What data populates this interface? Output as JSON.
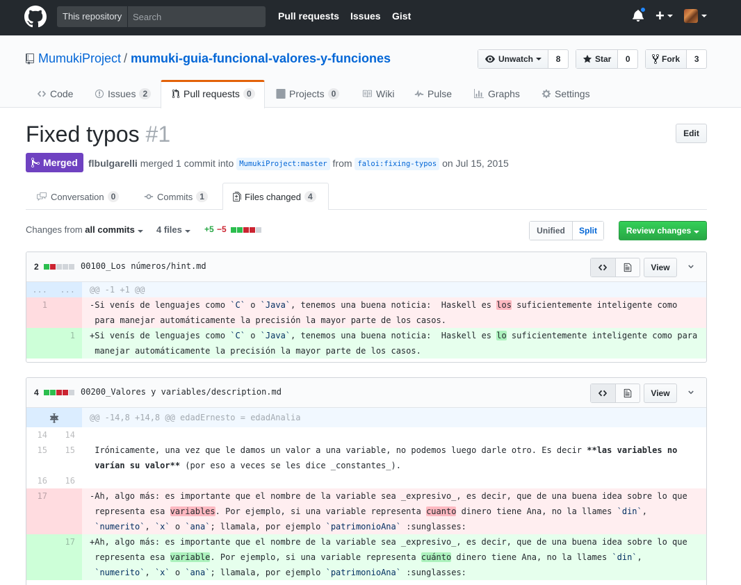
{
  "header": {
    "scope_label": "This repository",
    "search_placeholder": "Search",
    "nav": [
      "Pull requests",
      "Issues",
      "Gist"
    ]
  },
  "repo": {
    "owner": "MumukiProject",
    "separator": "/",
    "name": "mumuki-guia-funcional-valores-y-funciones",
    "watch_label": "Unwatch",
    "watch_count": "8",
    "star_label": "Star",
    "star_count": "0",
    "fork_label": "Fork",
    "fork_count": "3",
    "tabs": [
      {
        "label": "Code",
        "count": ""
      },
      {
        "label": "Issues",
        "count": "2"
      },
      {
        "label": "Pull requests",
        "count": "0"
      },
      {
        "label": "Projects",
        "count": "0"
      },
      {
        "label": "Wiki",
        "count": ""
      },
      {
        "label": "Pulse",
        "count": ""
      },
      {
        "label": "Graphs",
        "count": ""
      },
      {
        "label": "Settings",
        "count": ""
      }
    ]
  },
  "pr": {
    "title": "Fixed typos",
    "number": "#1",
    "edit_label": "Edit",
    "state": "Merged",
    "author": "flbulgarelli",
    "merged_text": "merged 1 commit into",
    "base_ref": "MumukiProject:master",
    "from_text": "from",
    "head_ref": "faloi:fixing-typos",
    "date_text": "on Jul 15, 2015",
    "tabs": [
      {
        "label": "Conversation",
        "count": "0"
      },
      {
        "label": "Commits",
        "count": "1"
      },
      {
        "label": "Files changed",
        "count": "4"
      }
    ]
  },
  "toolbar": {
    "changes_from": "Changes from",
    "changes_value": "all commits",
    "files_label": "4 files",
    "additions": "+5",
    "deletions": "−5",
    "unified_label": "Unified",
    "split_label": "Split",
    "review_label": "Review changes"
  },
  "files": [
    {
      "count": "2",
      "name": "00100_Los números/hint.md",
      "view_label": "View",
      "hunk_old": "...",
      "hunk_new": "...",
      "hunk": "@@ -1 +1 @@",
      "del_ln": "1",
      "del_pre": "-Si venís de lenguajes como ",
      "del_t1": "`C`",
      "del_mid1": " o ",
      "del_t2": "`Java`",
      "del_mid2": ", tenemos una buena noticia:  Haskell es ",
      "del_word": "los",
      "del_post": " suficientemente inteligente como",
      "del_line2": "para manejar automáticamente la precisión la mayor parte de los casos.",
      "add_ln": "1",
      "add_pre": "+Si venís de lenguajes como ",
      "add_t1": "`C`",
      "add_mid1": " o ",
      "add_t2": "`Java`",
      "add_mid2": ", tenemos una buena noticia:  Haskell es ",
      "add_word": "lo",
      "add_post": " suficientemente inteligente como para",
      "add_line2": "manejar automáticamente la precisión la mayor parte de los casos."
    },
    {
      "count": "4",
      "name": "00200_Valores y variables/description.md",
      "view_label": "View",
      "hunk": "@@ -14,8 +14,8 @@ edadErnesto = edadAnalia",
      "ctx1_old": "14",
      "ctx1_new": "14",
      "ctx2_old": "15",
      "ctx2_new": "15",
      "ctx2_a": "Irónicamente, una vez que le damos un valor a una variable, no podemos luego darle otro. Es decir ",
      "ctx2_b": "**las variables no",
      "ctx2_c": "varían su valor**",
      "ctx2_d": " (por eso a veces se les dice _constantes_).",
      "ctx3_old": "16",
      "ctx3_new": "16",
      "del_ln": "17",
      "del_a": "-Ah, algo más: es importante que el nombre de la variable sea _expresivo_, es decir, que de una buena idea sobre lo que",
      "del_b1": "representa esa ",
      "del_w1": "variables",
      "del_b2": ". Por ejemplo, si una variable representa ",
      "del_w2": "cuanto",
      "del_b3": " dinero tiene Ana, no la llames ",
      "del_t1": "`din`",
      "del_b4": ",",
      "add_ln": "17",
      "add_a": "+Ah, algo más: es importante que el nombre de la variable sea _expresivo_, es decir, que de una buena idea sobre lo que",
      "add_b1": "representa esa ",
      "add_w1": "variable",
      "add_b2": ". Por ejemplo, si una variable representa ",
      "add_w2": "cuánto",
      "add_b3": " dinero tiene Ana, no la llames ",
      "add_t1": "`din`",
      "add_b4": ",",
      "t_numerito": "`numerito`",
      "t_comma1": ", ",
      "t_x": "`x`",
      "t_o": " o ",
      "t_ana": "`ana`",
      "t_mid": "; llamala, por ejemplo ",
      "t_patrimonio": "`patrimonioAna`",
      "t_end": " :sunglasses:"
    }
  ],
  "colors": {
    "merged": "#6f42c1",
    "accent_tab": "#e36209",
    "review": "#28a745",
    "link": "#0366d6"
  }
}
